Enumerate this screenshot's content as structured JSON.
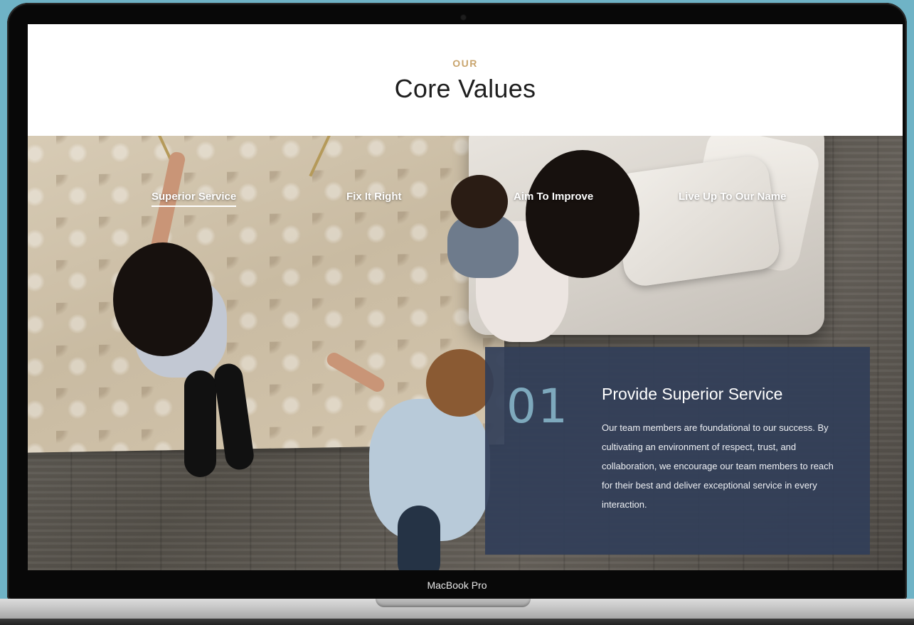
{
  "section": {
    "eyebrow": "OUR",
    "title": "Core Values"
  },
  "tabs": [
    {
      "label": "Superior Service",
      "active": true
    },
    {
      "label": "Fix It Right",
      "active": false
    },
    {
      "label": "Aim To Improve",
      "active": false
    },
    {
      "label": "Live Up To Our Name",
      "active": false
    }
  ],
  "value_card": {
    "number": "01",
    "heading": "Provide Superior Service",
    "body": "Our team members are foundational to our success. By cultivating an environment of respect, trust, and collaboration, we encourage our team members to reach for their best and deliver exceptional service in every interaction."
  },
  "device": {
    "label": "MacBook Pro"
  },
  "colors": {
    "background": "#6fb3c6",
    "eyebrow": "#c9a56e",
    "card": "#323e58",
    "number": "#7ea9bd"
  }
}
